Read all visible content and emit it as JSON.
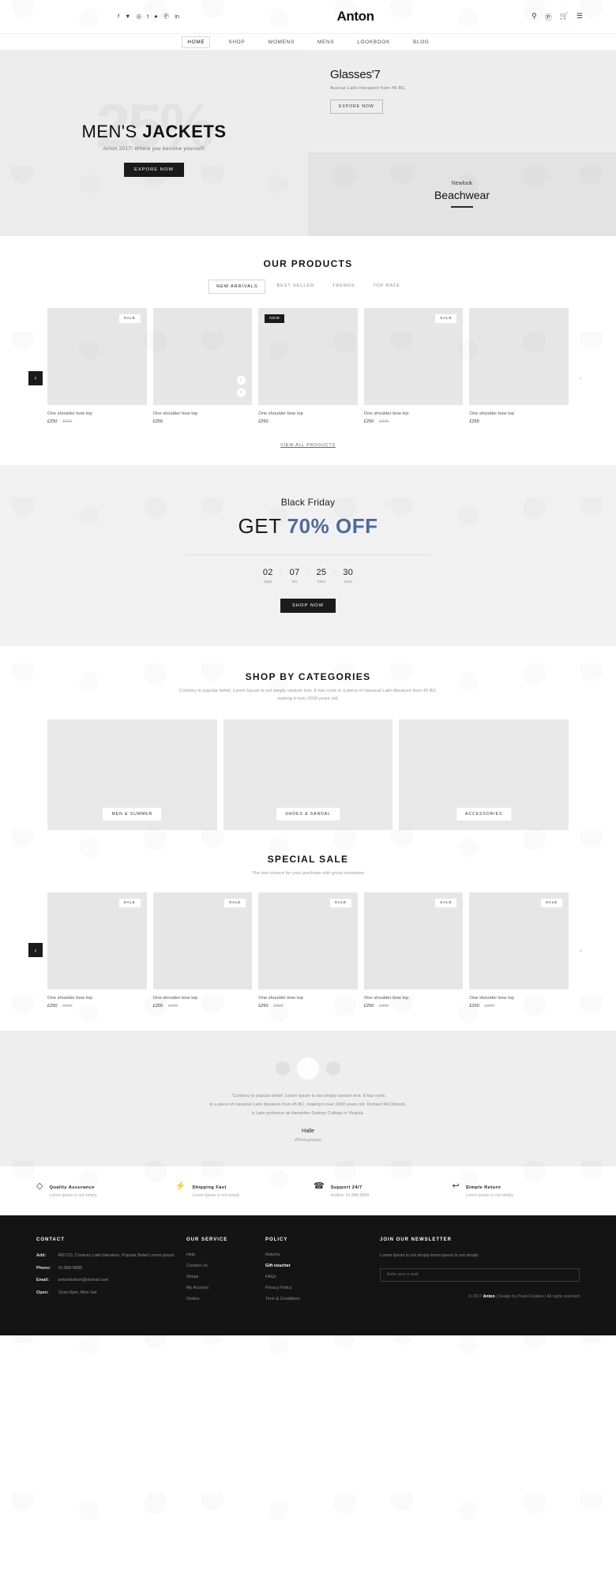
{
  "header": {
    "brand": "Anton",
    "social": [
      "f",
      "▼",
      "◎",
      "t",
      "●",
      "Ⓟ",
      "in"
    ],
    "icons": [
      "search-icon",
      "user-icon",
      "cart-icon",
      "menu-icon"
    ],
    "nav": [
      {
        "label": "HOME",
        "active": true
      },
      {
        "label": "SHOP",
        "active": false
      },
      {
        "label": "WOMENS",
        "active": false
      },
      {
        "label": "MENS",
        "active": false
      },
      {
        "label": "LOOKBOOK",
        "active": false
      },
      {
        "label": "BLOG",
        "active": false
      }
    ]
  },
  "hero": {
    "ghost_text": "25%",
    "title_light": "MEN'S",
    "title_bold": "JACKETS",
    "subtitle": "Anton 2017! Where you become yourself!",
    "cta": "EXPORE NOW",
    "right_top": {
      "title": "Glasses'7",
      "desc": "Assical Latin literature from 45 BC.",
      "cta": "EXPORE NOW"
    },
    "right_bottom": {
      "small": "Newlook",
      "big": "Beachwear"
    }
  },
  "products": {
    "title": "OUR PRODUCTS",
    "tabs": [
      {
        "label": "NEW ARRIVALS",
        "active": true
      },
      {
        "label": "BEST SELLER",
        "active": false
      },
      {
        "label": "TRENDS",
        "active": false
      },
      {
        "label": "TOP RATE",
        "active": false
      }
    ],
    "items": [
      {
        "name": "One shoulder bow top",
        "price": "£250",
        "old_price": "£300",
        "badge": "SALE",
        "badge_type": "sale"
      },
      {
        "name": "One shoulder bow top",
        "price": "£250",
        "old_price": "",
        "badge": "",
        "badge_type": ""
      },
      {
        "name": "One shoulder bow top",
        "price": "£250",
        "old_price": "",
        "badge": "NEW",
        "badge_type": "new"
      },
      {
        "name": "One shoulder bow top",
        "price": "£250",
        "old_price": "£300",
        "badge": "SALE",
        "badge_type": "sale"
      },
      {
        "name": "One shoulder bow top",
        "price": "£250",
        "old_price": "",
        "badge": "",
        "badge_type": ""
      }
    ],
    "view_all": "VIEW ALL PRODUCTS",
    "prev_icon": "‹",
    "next_icon": "›"
  },
  "black_friday": {
    "eyebrow": "Black Friday",
    "headline_plain": "GET ",
    "headline_accent": "70% OFF",
    "accent_color": "#4d6b9e",
    "countdown": [
      {
        "value": "02",
        "label": "days"
      },
      {
        "value": "07",
        "label": "hrs"
      },
      {
        "value": "25",
        "label": "mins"
      },
      {
        "value": "30",
        "label": "secs"
      }
    ],
    "cta": "SHOP NOW"
  },
  "categories": {
    "title": "SHOP BY CATEGORIES",
    "desc": "Contrary to popular belief, Lorem Ipsum is not simply random text. It has roots in a piece of classical Latin literature from 45 BC, making it over 2000 years old.",
    "items": [
      {
        "label": "MEN & SUMMER"
      },
      {
        "label": "SHOES & SANDAL"
      },
      {
        "label": "ACCESSORIES"
      }
    ]
  },
  "special_sale": {
    "title": "SPECIAL SALE",
    "desc": "The last chance for your purchase with great incentives",
    "items": [
      {
        "name": "One shoulder bow top",
        "price": "£250",
        "old_price": "£300",
        "badge": "SALE"
      },
      {
        "name": "One shoulder bow top",
        "price": "£250",
        "old_price": "£300",
        "badge": "SALE"
      },
      {
        "name": "One shoulder bow top",
        "price": "£250",
        "old_price": "£300",
        "badge": "SALE"
      },
      {
        "name": "One shoulder bow top",
        "price": "£250",
        "old_price": "£300",
        "badge": "SALE"
      },
      {
        "name": "One shoulder bow top",
        "price": "£250",
        "old_price": "£300",
        "badge": "SALE"
      }
    ],
    "prev_icon": "‹",
    "next_icon": "›"
  },
  "testimonial": {
    "quote_line1": "\"Contrary to popular belief, Lorem Ipsum is not simply random text. It has roots",
    "quote_line2": "in a piece of classical Latin literature from 45 BC, making it over 2000 years old. Richard McClintock,",
    "quote_line3": "a Latin professor at Hampden-Sydney College in Virginia.",
    "name": "Halle",
    "role": "#Photographer"
  },
  "features": [
    {
      "icon": "diamond-icon",
      "glyph": "◇",
      "title": "Quality Assurance",
      "desc": "Lorem Ipsum is not simply"
    },
    {
      "icon": "bolt-icon",
      "glyph": "⚡",
      "title": "Shipping Fast",
      "desc": "Lorem Ipsum is not simply"
    },
    {
      "icon": "headset-icon",
      "glyph": "☎",
      "title": "Support 24/7",
      "desc": "Hotline: 01-888-8888"
    },
    {
      "icon": "return-arrow-icon",
      "glyph": "↩",
      "title": "Simple Return",
      "desc": "Lorem Ipsum is not simply"
    }
  ],
  "footer": {
    "contact": {
      "heading": "CONTACT",
      "rows": [
        {
          "label": "Add:",
          "value": "450 CD, Contrary Latin literature, Popular Belief Lorem Ipsum"
        },
        {
          "label": "Phone:",
          "value": "01-888-8888"
        },
        {
          "label": "Email:",
          "value": "antonfashion@domail.com"
        },
        {
          "label": "Open:",
          "value": "11am-5pm, Mon-Sat"
        }
      ]
    },
    "service": {
      "heading": "OUR SERVICE",
      "links": [
        "Help",
        "Contact Us",
        "Shops",
        "My Account",
        "Orders"
      ]
    },
    "policy": {
      "heading": "POLICY",
      "links": [
        {
          "label": "Returns",
          "highlight": false
        },
        {
          "label": "Gift voucher",
          "highlight": true
        },
        {
          "label": "FAQs",
          "highlight": false
        },
        {
          "label": "Privacy Policy",
          "highlight": false
        },
        {
          "label": "Term & Conditions",
          "highlight": false
        }
      ]
    },
    "newsletter": {
      "heading": "JOIN OUR NEWSLETTER",
      "desc": "Lorem Ipsum is not simply lorem ipsum is not simply",
      "placeholder": "Enter your e-mail"
    },
    "copyright_prefix": "© 2017 ",
    "copyright_brand": "Anton",
    "copyright_suffix": " | Design by Pearl-Creative | All rights reserved"
  }
}
